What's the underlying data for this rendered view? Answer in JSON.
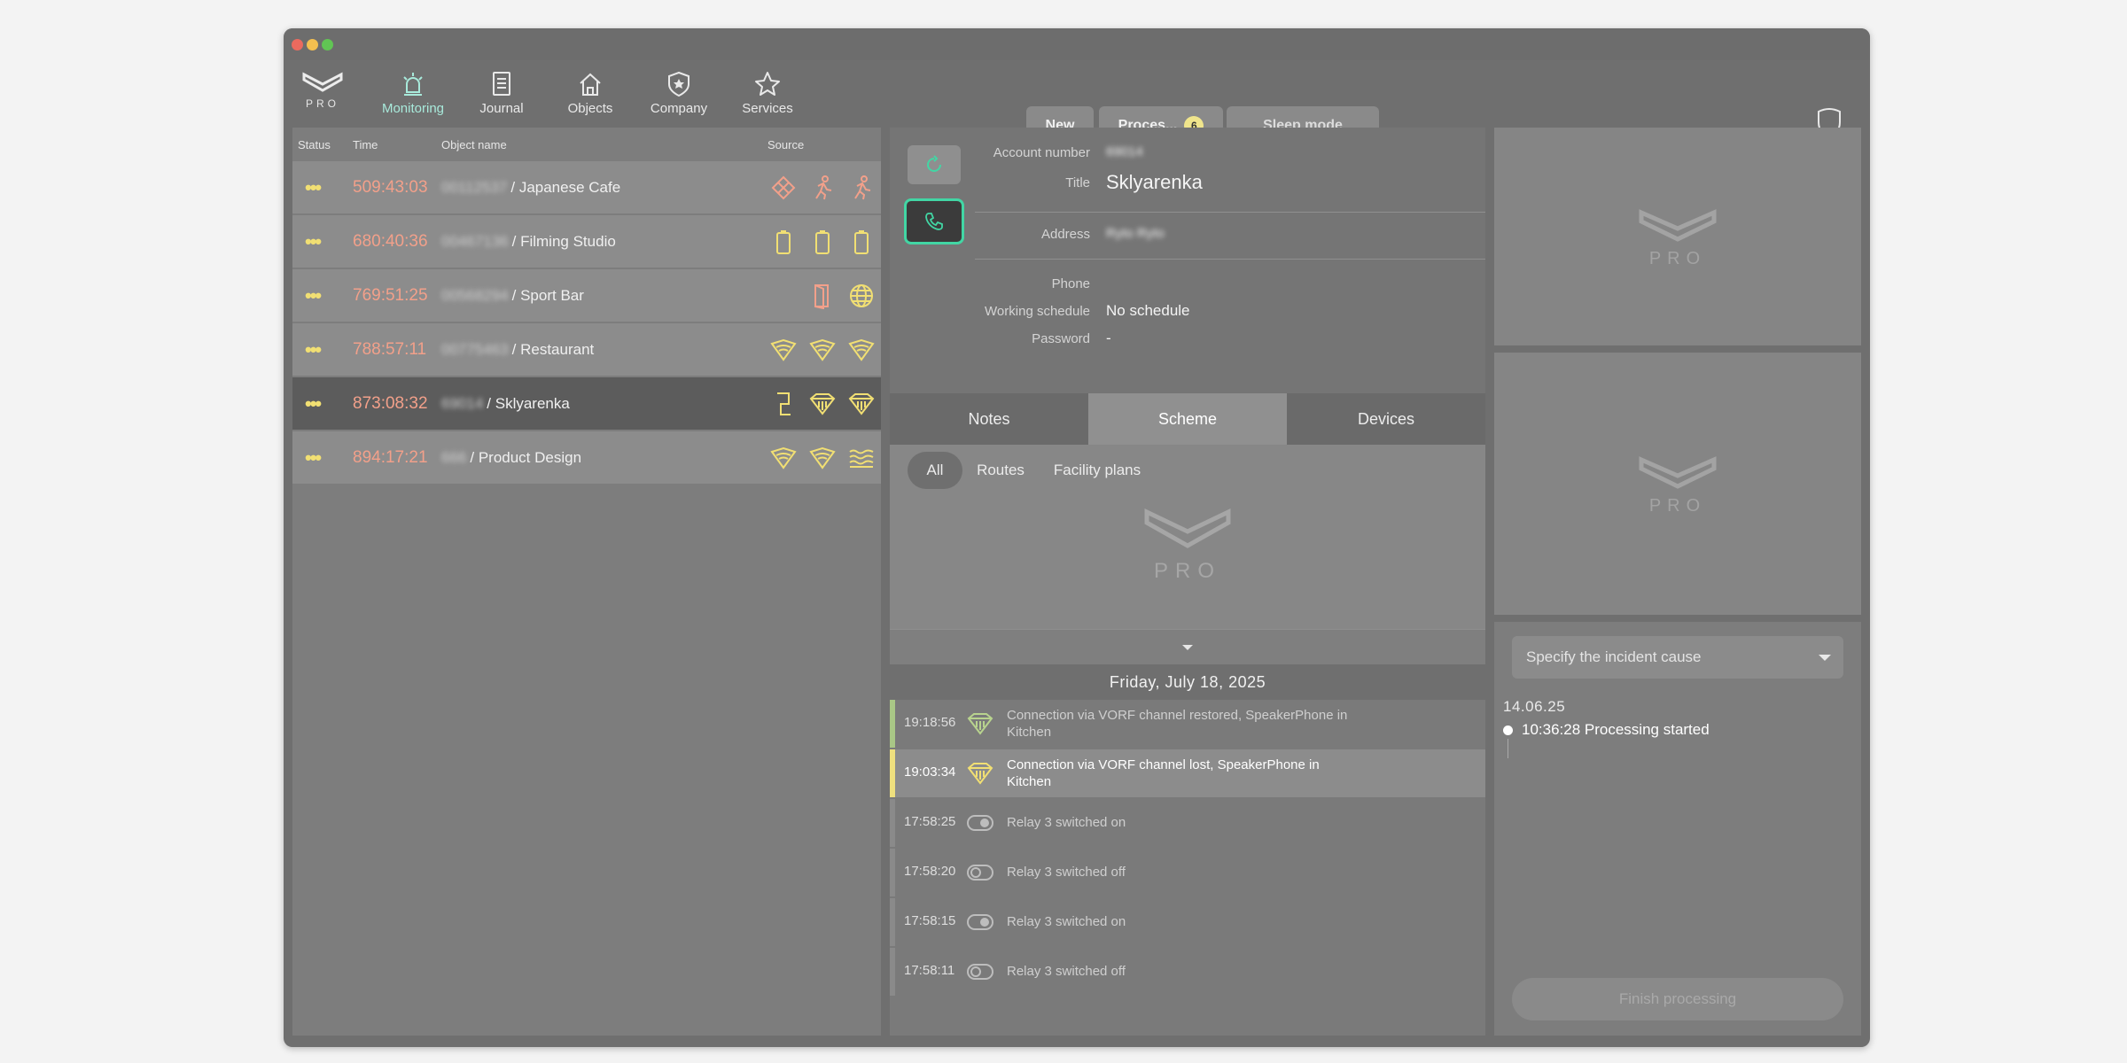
{
  "window": {
    "traffic_lights": [
      "close",
      "minimize",
      "maximize"
    ]
  },
  "logo": {
    "text": "PRO"
  },
  "nav": [
    {
      "label": "Monitoring",
      "icon": "siren-icon",
      "active": true
    },
    {
      "label": "Journal",
      "icon": "journal-icon"
    },
    {
      "label": "Objects",
      "icon": "house-icon"
    },
    {
      "label": "Company",
      "icon": "company-shield-icon"
    },
    {
      "label": "Services",
      "icon": "star-icon"
    }
  ],
  "header_buttons": {
    "new": "New",
    "processing": "Proces...",
    "processing_count": "6",
    "sleep": "Sleep mode"
  },
  "events_table": {
    "headers": {
      "status": "Status",
      "time": "Time",
      "object": "Object name",
      "source": "Source"
    },
    "rows": [
      {
        "status": "•••",
        "time": "509:43:03",
        "object_id": "00112537",
        "object_name": "/ Japanese Cafe",
        "icons": [
          "tamper-icon",
          "motion-icon",
          "motion-icon"
        ],
        "icon_color": "#f2a08a"
      },
      {
        "status": "•••",
        "time": "680:40:36",
        "object_id": "00467136",
        "object_name": "/ Filming Studio",
        "icons": [
          "battery-icon",
          "battery-icon",
          "battery-icon"
        ],
        "icon_color": "#f1df73"
      },
      {
        "status": "•••",
        "time": "769:51:25",
        "object_id": "00568294",
        "object_name": "/ Sport Bar",
        "icons": [
          "door-icon",
          "globe-icon"
        ],
        "icon_color": "#f2a08a"
      },
      {
        "status": "•••",
        "time": "788:57:11",
        "object_id": "00775463",
        "object_name": "/ Restaurant",
        "icons": [
          "wifi-diamond-icon",
          "wifi-diamond-icon",
          "wifi-diamond-icon"
        ],
        "icon_color": "#f1df73"
      },
      {
        "status": "•••",
        "time": "873:08:32",
        "object_id": "69014",
        "object_name": "/ Sklyarenka",
        "icons": [
          "relay-icon",
          "gem-icon",
          "gem-icon"
        ],
        "icon_color": "#f1df73",
        "selected": true
      },
      {
        "status": "•••",
        "time": "894:17:21",
        "object_id": "666",
        "object_name": "/ Product Design",
        "icons": [
          "wifi-diamond-icon",
          "wifi-diamond-icon",
          "leak-icon"
        ],
        "icon_color": "#f1df73"
      }
    ]
  },
  "object_info": {
    "account_label": "Account number",
    "account_value": "69014",
    "title_label": "Title",
    "title_value": "Sklyarenka",
    "address_label": "Address",
    "address_value": "Ryto Ryto",
    "phone_label": "Phone",
    "phone_value": "",
    "schedule_label": "Working schedule",
    "schedule_value": "No schedule",
    "password_label": "Password",
    "password_value": "-"
  },
  "tabs": [
    "Notes",
    "Scheme",
    "Devices"
  ],
  "active_tab": "Scheme",
  "scheme_tabs": [
    "All",
    "Routes",
    "Facility plans"
  ],
  "active_scheme_tab": "All",
  "journal": {
    "date": "Friday, July 18, 2025",
    "entries": [
      {
        "time": "19:18:56",
        "text": "Connection via VORF channel restored, SpeakerPhone in Kitchen",
        "icon": "gem-icon",
        "marker": "green"
      },
      {
        "time": "19:03:34",
        "text": "Connection via VORF channel lost, SpeakerPhone in Kitchen",
        "icon": "gem-icon",
        "marker": "yellow"
      },
      {
        "time": "17:58:25",
        "text": "Relay 3 switched on",
        "icon": "toggle-on-icon",
        "marker": "gray"
      },
      {
        "time": "17:58:20",
        "text": "Relay 3 switched off",
        "icon": "toggle-off-icon",
        "marker": "gray"
      },
      {
        "time": "17:58:15",
        "text": "Relay 3 switched on",
        "icon": "toggle-on-icon",
        "marker": "gray"
      },
      {
        "time": "17:58:11",
        "text": "Relay 3 switched off",
        "icon": "toggle-off-icon",
        "marker": "gray"
      }
    ]
  },
  "incident": {
    "cause_placeholder": "Specify the incident cause",
    "date": "14.06.25",
    "entry": "10:36:28 Processing started",
    "finish_label": "Finish processing"
  },
  "colors": {
    "accent": "#42d6a4",
    "alarm_time": "#f2a08a",
    "status_dots": "#f1df73",
    "active_nav": "#a8eadb"
  }
}
